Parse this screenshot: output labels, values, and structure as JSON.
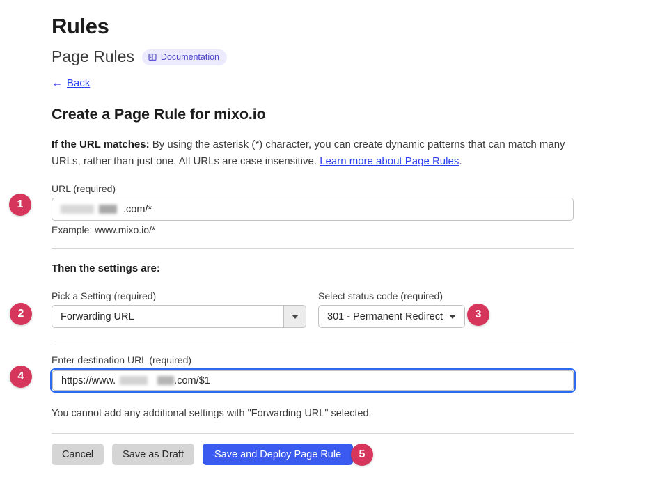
{
  "header": {
    "title": "Rules",
    "subtitle": "Page Rules",
    "doc_badge": "Documentation",
    "doc_icon": "book-icon"
  },
  "back": {
    "arrow": "←",
    "label": "Back"
  },
  "form": {
    "title": "Create a Page Rule for mixo.io",
    "intro": {
      "lead": "If the URL matches:",
      "body": " By using the asterisk (*) character, you can create dynamic patterns that can match many URLs, rather than just one. All URLs are case insensitive. ",
      "link": "Learn more about Page Rules",
      "tail": "."
    },
    "url": {
      "label": "URL (required)",
      "redacted_1": "",
      "redacted_2": "",
      "value_suffix": ".com/*",
      "example": "Example: www.mixo.io/*"
    },
    "settings_title": "Then the settings are:",
    "pick_setting": {
      "label": "Pick a Setting (required)",
      "value": "Forwarding URL",
      "caret": "chevron-down-icon"
    },
    "status_code": {
      "label": "Select status code (required)",
      "value": "301 - Permanent Redirect",
      "caret": "chevron-down-icon"
    },
    "destination": {
      "label": "Enter destination URL (required)",
      "prefix": "https://www.",
      "redacted_1": "",
      "redacted_2": "",
      "suffix": ".com/$1"
    },
    "note": "You cannot add any additional settings with \"Forwarding URL\" selected."
  },
  "buttons": {
    "cancel": "Cancel",
    "save_draft": "Save as Draft",
    "save_deploy": "Save and Deploy Page Rule"
  },
  "steps": {
    "s1": "1",
    "s2": "2",
    "s3": "3",
    "s4": "4",
    "s5": "5"
  },
  "colors": {
    "accent_blue": "#3a5af0",
    "link_blue": "#2c3ff0",
    "focus_blue": "#2c6bf0",
    "badge_crimson": "#d6365c",
    "doc_badge_bg": "#eceafd",
    "doc_badge_fg": "#4b44c9"
  }
}
